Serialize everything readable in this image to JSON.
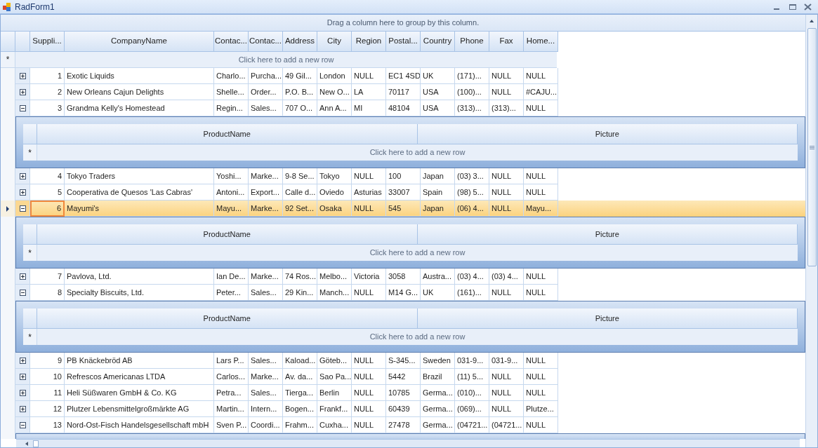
{
  "window": {
    "title": "RadForm1"
  },
  "group_panel": {
    "text": "Drag a column here to group by this column."
  },
  "columns": [
    "Suppli...",
    "CompanyName",
    "Contac...",
    "Contac...",
    "Address",
    "City",
    "Region",
    "Postal...",
    "Country",
    "Phone",
    "Fax",
    "Home..."
  ],
  "new_row": {
    "marker": "*",
    "text": "Click here to add a new row"
  },
  "rows": [
    {
      "expanded": false,
      "selected": false,
      "cells": [
        "1",
        "Exotic Liquids",
        "Charlo...",
        "Purcha...",
        "49 Gil...",
        "London",
        "NULL",
        "EC1 4SD",
        "UK",
        "(171)...",
        "NULL",
        "NULL"
      ]
    },
    {
      "expanded": false,
      "selected": false,
      "cells": [
        "2",
        "New Orleans Cajun Delights",
        "Shelle...",
        "Order...",
        "P.O. B...",
        "New O...",
        "LA",
        "70117",
        "USA",
        "(100)...",
        "NULL",
        "#CAJU..."
      ]
    },
    {
      "expanded": true,
      "selected": false,
      "cells": [
        "3",
        "Grandma Kelly's Homestead",
        "Regin...",
        "Sales...",
        "707 O...",
        "Ann A...",
        "MI",
        "48104",
        "USA",
        "(313)...",
        "(313)...",
        "NULL"
      ],
      "detail": {
        "columns": [
          "ProductName",
          "Picture"
        ],
        "new_row_marker": "*",
        "new_row_text": "Click here to add a new row"
      }
    },
    {
      "expanded": false,
      "selected": false,
      "cells": [
        "4",
        "Tokyo Traders",
        "Yoshi...",
        "Marke...",
        "9-8 Se...",
        "Tokyo",
        "NULL",
        "100",
        "Japan",
        "(03) 3...",
        "NULL",
        "NULL"
      ]
    },
    {
      "expanded": false,
      "selected": false,
      "cells": [
        "5",
        "Cooperativa de Quesos 'Las Cabras'",
        "Antoni...",
        "Export...",
        "Calle d...",
        "Oviedo",
        "Asturias",
        "33007",
        "Spain",
        "(98) 5...",
        "NULL",
        "NULL"
      ]
    },
    {
      "expanded": true,
      "selected": true,
      "cells": [
        "6",
        "Mayumi's",
        "Mayu...",
        "Marke...",
        "92 Set...",
        "Osaka",
        "NULL",
        "545",
        "Japan",
        "(06) 4...",
        "NULL",
        "Mayu..."
      ],
      "detail": {
        "columns": [
          "ProductName",
          "Picture"
        ],
        "new_row_marker": "*",
        "new_row_text": "Click here to add a new row"
      }
    },
    {
      "expanded": false,
      "selected": false,
      "cells": [
        "7",
        "Pavlova, Ltd.",
        "Ian De...",
        "Marke...",
        "74 Ros...",
        "Melbo...",
        "Victoria",
        "3058",
        "Austra...",
        "(03) 4...",
        "(03) 4...",
        "NULL"
      ]
    },
    {
      "expanded": true,
      "selected": false,
      "cells": [
        "8",
        "Specialty Biscuits, Ltd.",
        "Peter...",
        "Sales...",
        "29 Kin...",
        "Manch...",
        "NULL",
        "M14 G...",
        "UK",
        "(161)...",
        "NULL",
        "NULL"
      ],
      "detail": {
        "columns": [
          "ProductName",
          "Picture"
        ],
        "new_row_marker": "*",
        "new_row_text": "Click here to add a new row"
      }
    },
    {
      "expanded": false,
      "selected": false,
      "cells": [
        "9",
        "PB Knäckebröd AB",
        "Lars P...",
        "Sales...",
        "Kaload...",
        "Göteb...",
        "NULL",
        "S-345...",
        "Sweden",
        "031-9...",
        "031-9...",
        "NULL"
      ]
    },
    {
      "expanded": false,
      "selected": false,
      "cells": [
        "10",
        "Refrescos Americanas LTDA",
        "Carlos...",
        "Marke...",
        "Av. da...",
        "Sao Pa...",
        "NULL",
        "5442",
        "Brazil",
        "(11) 5...",
        "NULL",
        "NULL"
      ]
    },
    {
      "expanded": false,
      "selected": false,
      "cells": [
        "11",
        "Heli Süßwaren GmbH & Co. KG",
        "Petra...",
        "Sales...",
        "Tierga...",
        "Berlin",
        "NULL",
        "10785",
        "Germa...",
        "(010)...",
        "NULL",
        "NULL"
      ]
    },
    {
      "expanded": false,
      "selected": false,
      "cells": [
        "12",
        "Plutzer Lebensmittelgroßmärkte AG",
        "Martin...",
        "Intern...",
        "Bogen...",
        "Frankf...",
        "NULL",
        "60439",
        "Germa...",
        "(069)...",
        "NULL",
        "Plutze..."
      ]
    },
    {
      "expanded": true,
      "selected": false,
      "cells": [
        "13",
        "Nord-Ost-Fisch Handelsgesellschaft mbH",
        "Sven P...",
        "Coordi...",
        "Frahm...",
        "Cuxha...",
        "NULL",
        "27478",
        "Germa...",
        "(04721...",
        "(04721...",
        "NULL"
      ]
    }
  ]
}
